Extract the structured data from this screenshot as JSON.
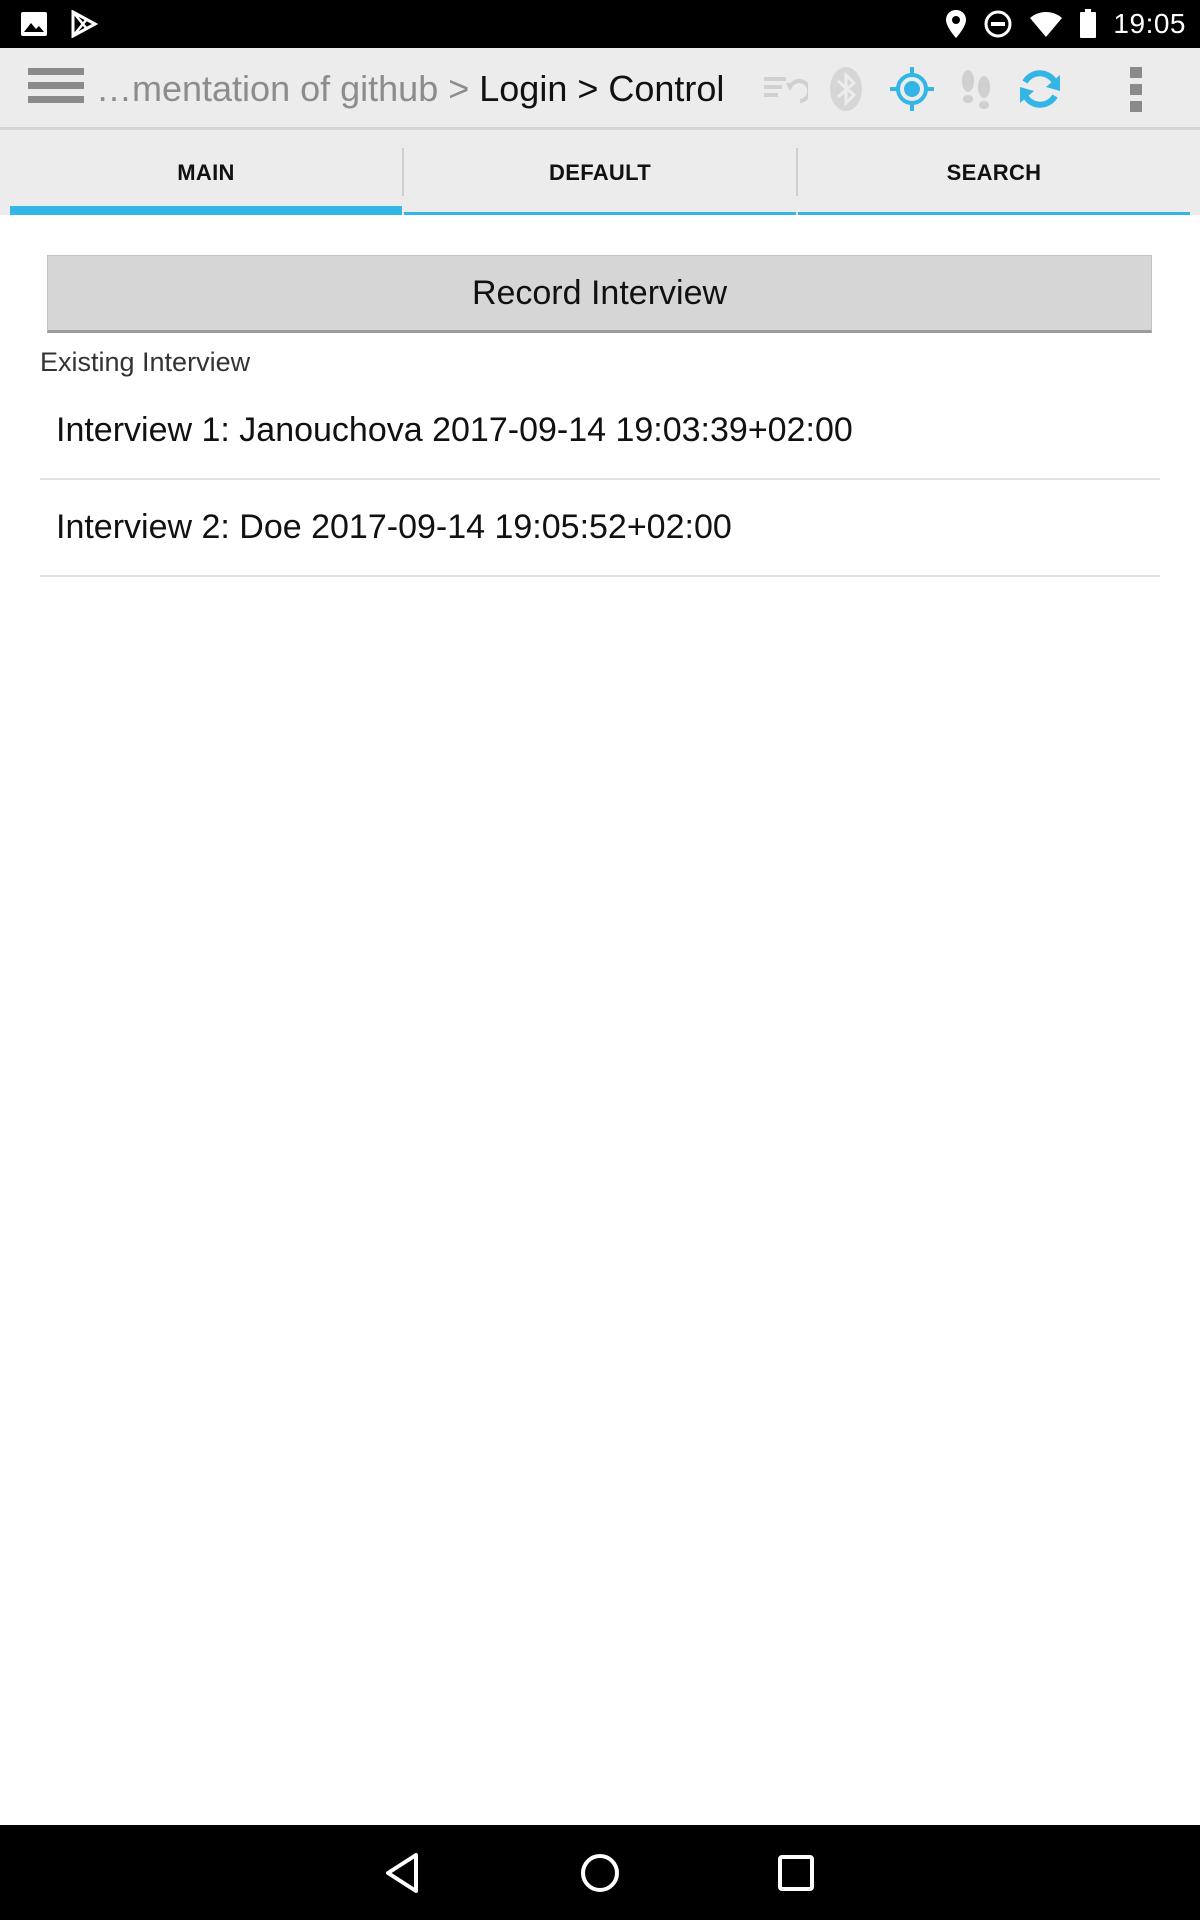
{
  "status_bar": {
    "time": "19:05",
    "icons": [
      "image-icon",
      "play-store-icon",
      "location-icon",
      "do-not-disturb-icon",
      "wifi-icon",
      "battery-icon"
    ]
  },
  "action_bar": {
    "breadcrumb_prefix": "…mentation of github",
    "breadcrumb_sep1": " > ",
    "breadcrumb_mid": "Login",
    "breadcrumb_sep2": " > ",
    "breadcrumb_current": "Control",
    "icons": [
      "sync-list-icon",
      "bluetooth-icon",
      "gps-icon",
      "footsteps-icon",
      "refresh-icon",
      "overflow-menu-icon"
    ]
  },
  "tabs": [
    {
      "label": "MAIN",
      "active": true
    },
    {
      "label": "DEFAULT",
      "active": false
    },
    {
      "label": "SEARCH",
      "active": false
    }
  ],
  "main": {
    "record_button": "Record Interview",
    "section_label": "Existing Interview",
    "interviews": [
      "Interview 1: Janouchova 2017-09-14 19:03:39+02:00",
      "Interview 2: Doe 2017-09-14 19:05:52+02:00"
    ]
  },
  "colors": {
    "accent": "#33b5e5",
    "icon_dim": "#d0d0d0",
    "icon_grey": "#8a8a8a"
  }
}
